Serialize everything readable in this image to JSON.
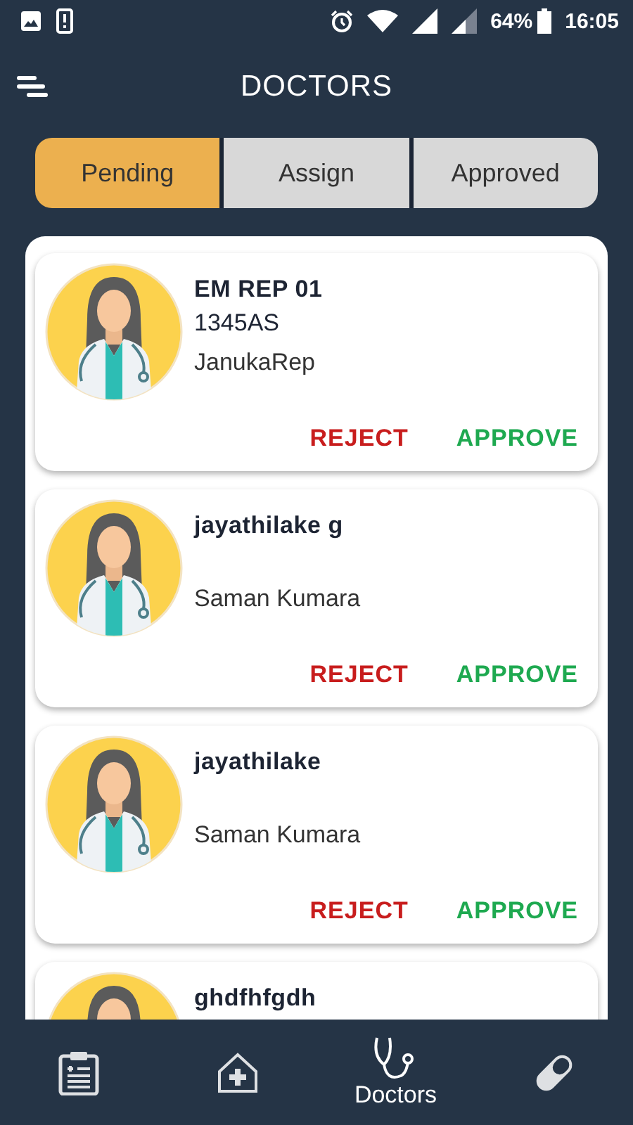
{
  "status_bar": {
    "battery": "64%",
    "time": "16:05"
  },
  "header": {
    "title": "DOCTORS"
  },
  "tabs": [
    {
      "label": "Pending",
      "selected": true
    },
    {
      "label": "Assign",
      "selected": false
    },
    {
      "label": "Approved",
      "selected": false
    }
  ],
  "doctors": [
    {
      "name": "EM REP 01",
      "code": "1345AS",
      "rep": "JanukaRep",
      "actions": [
        "REJECT",
        "APPROVE"
      ]
    },
    {
      "name": "jayathilake g",
      "rep": "Saman Kumara",
      "actions": [
        "REJECT",
        "APPROVE"
      ]
    },
    {
      "name": "jayathilake",
      "rep": "Saman Kumara",
      "actions": [
        "REJECT",
        "APPROVE"
      ]
    },
    {
      "name": "ghdfhfgdh"
    }
  ],
  "bottom_nav": [
    {
      "kind": "reports",
      "selected": false
    },
    {
      "kind": "hospital",
      "selected": false
    },
    {
      "kind": "doctors",
      "label": "Doctors",
      "selected": true
    },
    {
      "kind": "medicine",
      "selected": false
    }
  ]
}
